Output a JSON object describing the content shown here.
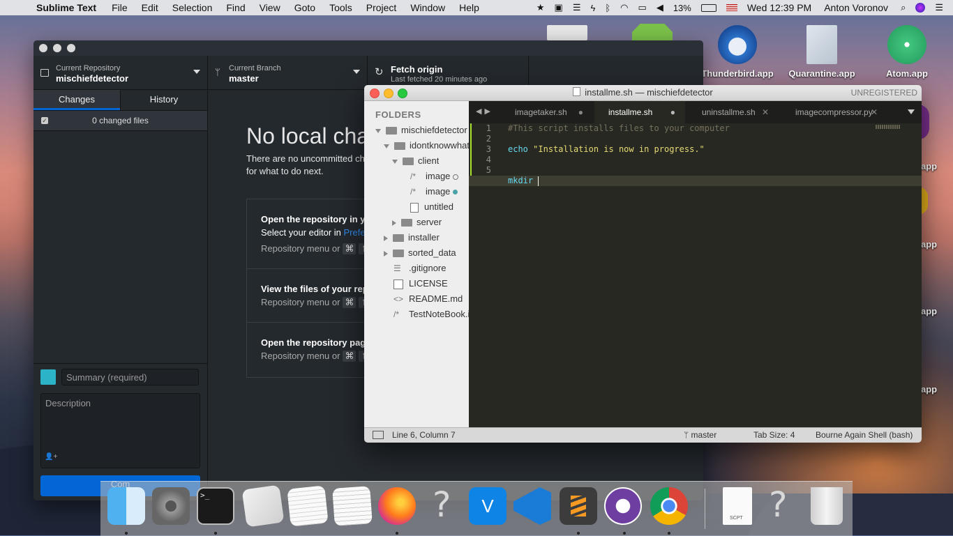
{
  "menubar": {
    "app_name": "Sublime Text",
    "items": [
      "File",
      "Edit",
      "Selection",
      "Find",
      "View",
      "Goto",
      "Tools",
      "Project",
      "Window",
      "Help"
    ],
    "battery": "13%",
    "clock": "Wed 12:39 PM",
    "user": "Anton Voronov"
  },
  "desktop": {
    "icons": [
      "Thunderbird.app",
      "Quarantine.app",
      "Atom.app"
    ],
    "partial_labels": [
      "app",
      "app",
      "app",
      "app"
    ]
  },
  "github": {
    "repo_label": "Current Repository",
    "repo_name": "mischiefdetector",
    "branch_label": "Current Branch",
    "branch_name": "master",
    "fetch_title": "Fetch origin",
    "fetch_sub": "Last fetched 20 minutes ago",
    "tab_changes": "Changes",
    "tab_history": "History",
    "changed_files": "0 changed files",
    "summary_placeholder": "Summary (required)",
    "description_placeholder": "Description",
    "commit_label": "Com",
    "heading": "No local cha",
    "para1": "There are no uncommitted ch",
    "para2": "for what to do next.",
    "card1_title": "Open the repository in yo",
    "card1_sub_a": "Select your editor in ",
    "card1_sub_link": "Prefe",
    "card1_sub2": "Repository menu or",
    "card2_title": "View the files of your rep",
    "card2_sub": "Repository menu or",
    "card3_title": "Open the repository page",
    "card3_sub": "Repository menu or",
    "cmd_key": "⌘",
    "shift_key": "⇧"
  },
  "sublime": {
    "title": "installme.sh — mischiefdetector",
    "unregistered": "UNREGISTERED",
    "folders_label": "FOLDERS",
    "tree": [
      "mischiefdetector",
      "idontknowwhat",
      "client",
      "image",
      "image",
      "untitled",
      "server",
      "installer",
      "sorted_data",
      ".gitignore",
      "LICENSE",
      "README.md",
      "TestNoteBook.i"
    ],
    "tabs": [
      "imagetaker.sh",
      "installme.sh",
      "uninstallme.sh",
      "imagecompressor.py"
    ],
    "line_numbers": [
      "1",
      "2",
      "3",
      "4",
      "5",
      "6"
    ],
    "code": {
      "l1": "#This script installs files to your computer",
      "l3_kw": "echo",
      "l3_str": "\"Installation is now in progress.\"",
      "l6": "mkdir "
    },
    "status": {
      "position": "Line 6, Column 7",
      "branch": "master",
      "tab_size": "Tab Size: 4",
      "syntax": "Bourne Again Shell (bash)"
    }
  },
  "dock": {
    "apps": [
      "finder-icon",
      "system-preferences-icon",
      "terminal-icon",
      "script-editor-icon",
      "textedit-icon",
      "notes-icon",
      "firefox-icon",
      "unknown-app-icon",
      "vnc-icon",
      "vscode-icon",
      "sublime-icon",
      "github-desktop-icon",
      "chrome-icon",
      "scpt-file-icon",
      "unknown-file-icon",
      "trash-icon"
    ],
    "scpt_label": "SCPT"
  },
  "colors": {
    "accent_blue": "#0366d6",
    "monokai_bg": "#272822",
    "git_added": "#a6e22e"
  }
}
